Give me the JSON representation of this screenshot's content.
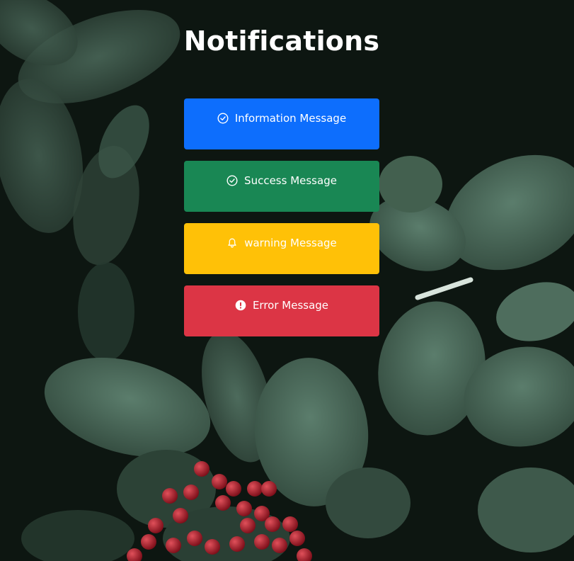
{
  "header": {
    "title": "Notifications"
  },
  "notifications": [
    {
      "label": "Information Message",
      "icon": "check-circle-icon",
      "color": "#0d6efd"
    },
    {
      "label": "Success Message",
      "icon": "check-circle-icon",
      "color": "#198754"
    },
    {
      "label": "warning Message",
      "icon": "bell-icon",
      "color": "#ffc107"
    },
    {
      "label": "Error Message",
      "icon": "exclamation-circle-icon",
      "color": "#dc3545"
    }
  ]
}
